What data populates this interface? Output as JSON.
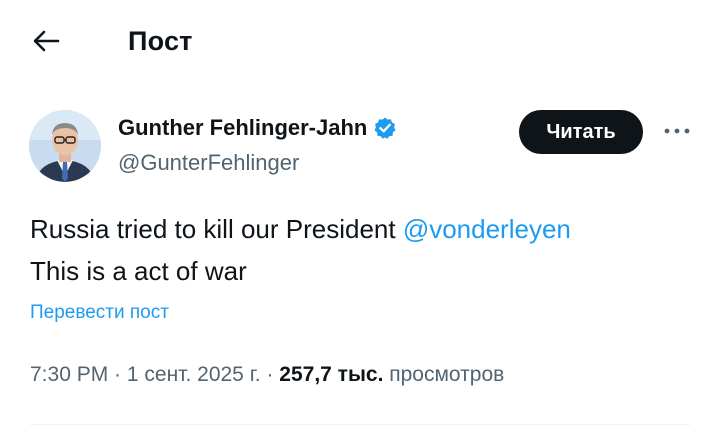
{
  "header": {
    "back_icon": "arrow-left-icon",
    "title": "Пост"
  },
  "author": {
    "name": "Gunther Fehlinger-Jahn",
    "handle": "@GunterFehlinger",
    "verified": true,
    "verified_color": "#1d9bf0",
    "avatar_icon": "avatar-photo"
  },
  "actions": {
    "follow_label": "Читать",
    "more_icon": "more-horizontal-icon"
  },
  "post": {
    "line1_text": "Russia tried to kill our President ",
    "mention": "@vonderleyen",
    "line2_text": "This is a act of war",
    "translate_label": "Перевести пост"
  },
  "meta": {
    "time": "7:30 PM",
    "sep1": " · ",
    "date": "1 сент. 2025 г.",
    "sep2": " · ",
    "views_count": "257,7 тыс.",
    "views_label": " просмотров"
  },
  "colors": {
    "accent": "#1d9bf0",
    "text": "#0f1419",
    "secondary": "#536471",
    "button_bg": "#0f1419"
  }
}
